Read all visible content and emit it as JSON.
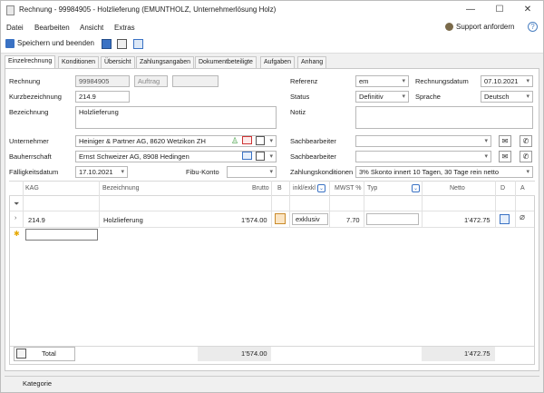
{
  "window": {
    "title": "Rechnung - 99984905 - Holzlieferung (EMUNTHOLZ, Unternehmerlösung Holz)"
  },
  "menu": {
    "items": [
      "Datei",
      "Bearbeiten",
      "Ansicht",
      "Extras"
    ],
    "support": "Support anfordern"
  },
  "toolbar": {
    "save_close": "Speichern und beenden"
  },
  "tabs": [
    "Einzelrechnung",
    "Konditionen",
    "Übersicht",
    "Zahlungsangaben",
    "Dokumentbeteiligte",
    "Aufgaben",
    "Anhang"
  ],
  "form": {
    "rechnung_label": "Rechnung",
    "rechnung_value": "99984905",
    "auftrag_label": "Auftrag",
    "kurz_label": "Kurzbezeichnung",
    "kurz_value": "214.9",
    "bez_label": "Bezeichnung",
    "bez_value": "Holzlieferung",
    "unternehmer_label": "Unternehmer",
    "unternehmer_value": "Heiniger & Partner AG, 8620 Wetzikon ZH",
    "bauherr_label": "Bauherrschaft",
    "bauherr_value": "Ernst Schweizer AG, 8908 Hedingen",
    "faellig_label": "Fälligkeitsdatum",
    "faellig_value": "17.10.2021",
    "fibu_label": "Fibu-Konto",
    "referenz_label": "Referenz",
    "referenz_value": "em",
    "rdatum_label": "Rechnungsdatum",
    "rdatum_value": "07.10.2021",
    "status_label": "Status",
    "status_value": "Definitiv",
    "sprache_label": "Sprache",
    "sprache_value": "Deutsch",
    "notiz_label": "Notiz",
    "sach1_label": "Sachbearbeiter",
    "sach2_label": "Sachbearbeiter",
    "zahl_label": "Zahlungskonditionen",
    "zahl_value": "3% Skonto innert 10 Tagen, 30 Tage rein netto"
  },
  "grid": {
    "headers": {
      "kag": "KAG",
      "bez": "Bezeichnung",
      "brutto": "Brutto",
      "b": "B",
      "inkl": "inkl/exkl",
      "mwst": "MWST %",
      "typ": "Typ",
      "netto": "Netto",
      "d": "D",
      "a": "A"
    },
    "row": {
      "kag": "214.9",
      "bez": "Holzlieferung",
      "brutto": "1'574.00",
      "inkl": "exklusiv",
      "mwst": "7.70",
      "netto": "1'472.75"
    },
    "footer": {
      "total_label": "Total",
      "brutto_total": "1'574.00",
      "netto_total": "1'472.75"
    }
  },
  "statusbar": {
    "kategorie": "Kategorie"
  }
}
